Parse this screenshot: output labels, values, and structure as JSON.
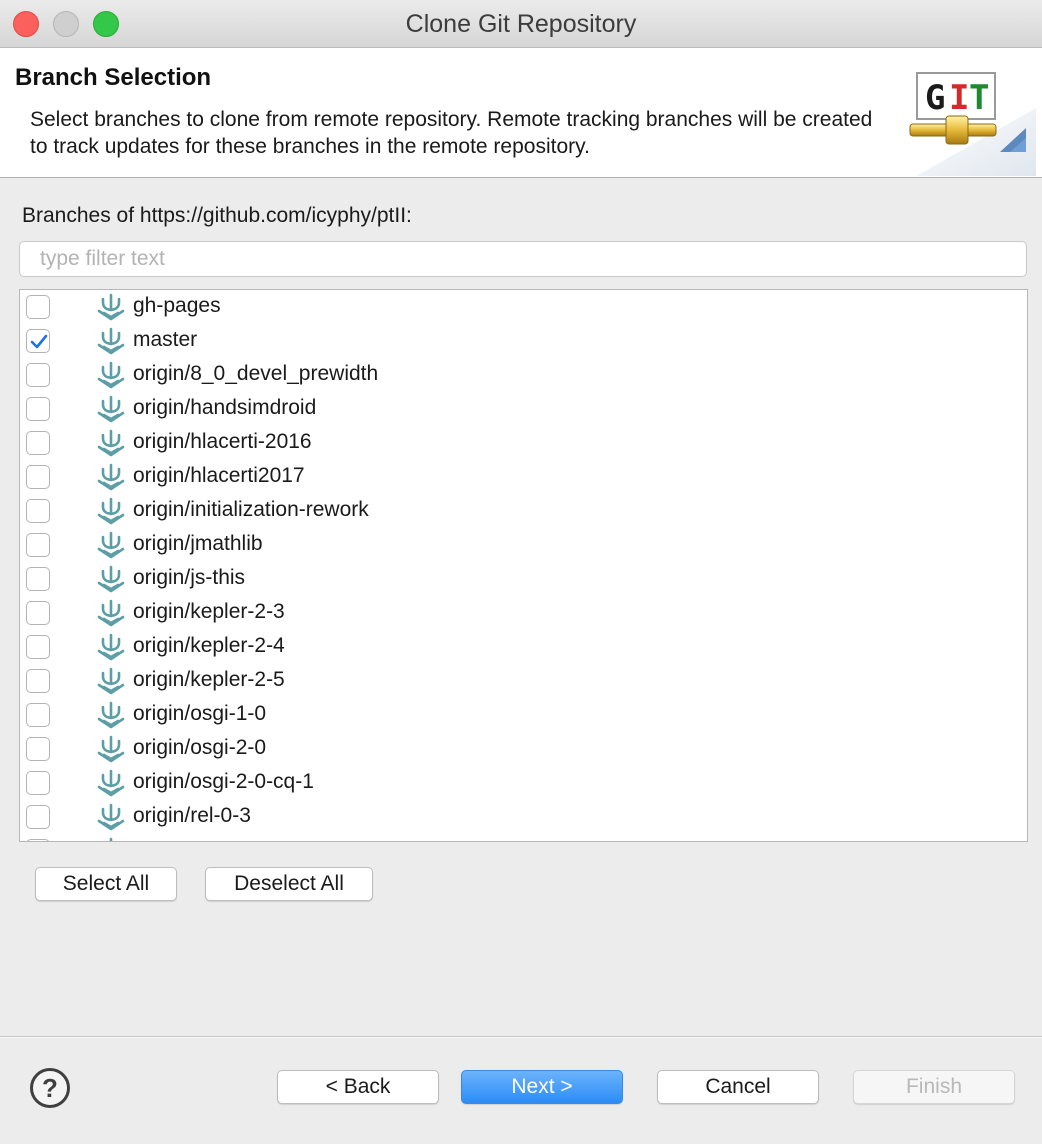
{
  "window": {
    "title": "Clone Git Repository"
  },
  "banner": {
    "title": "Branch Selection",
    "description": "Select branches to clone from remote repository. Remote tracking branches will be created to track updates for these branches in the remote repository.",
    "logo_text_g": "G",
    "logo_text_i": "I",
    "logo_text_t": "T"
  },
  "branches": {
    "label": "Branches of https://github.com/icyphy/ptII:",
    "filter_placeholder": "type filter text",
    "items": [
      {
        "label": "gh-pages",
        "checked": false
      },
      {
        "label": "master",
        "checked": true
      },
      {
        "label": "origin/8_0_devel_prewidth",
        "checked": false
      },
      {
        "label": "origin/handsimdroid",
        "checked": false
      },
      {
        "label": "origin/hlacerti-2016",
        "checked": false
      },
      {
        "label": "origin/hlacerti2017",
        "checked": false
      },
      {
        "label": "origin/initialization-rework",
        "checked": false
      },
      {
        "label": "origin/jmathlib",
        "checked": false
      },
      {
        "label": "origin/js-this",
        "checked": false
      },
      {
        "label": "origin/kepler-2-3",
        "checked": false
      },
      {
        "label": "origin/kepler-2-4",
        "checked": false
      },
      {
        "label": "origin/kepler-2-5",
        "checked": false
      },
      {
        "label": "origin/osgi-1-0",
        "checked": false
      },
      {
        "label": "origin/osgi-2-0",
        "checked": false
      },
      {
        "label": "origin/osgi-2-0-cq-1",
        "checked": false
      },
      {
        "label": "origin/rel-0-3",
        "checked": false
      }
    ],
    "select_all_label": "Select All",
    "deselect_all_label": "Deselect All"
  },
  "footer": {
    "help_label": "?",
    "back_label": "< Back",
    "next_label": "Next >",
    "cancel_label": "Cancel",
    "finish_label": "Finish"
  },
  "colors": {
    "accent": "#2a8cf7",
    "checkmark": "#1f73e0",
    "branch_icon": "#5b9ea6"
  },
  "icons": {
    "branch": "branch-icon",
    "help": "help-icon",
    "checkbox": "checkbox"
  }
}
